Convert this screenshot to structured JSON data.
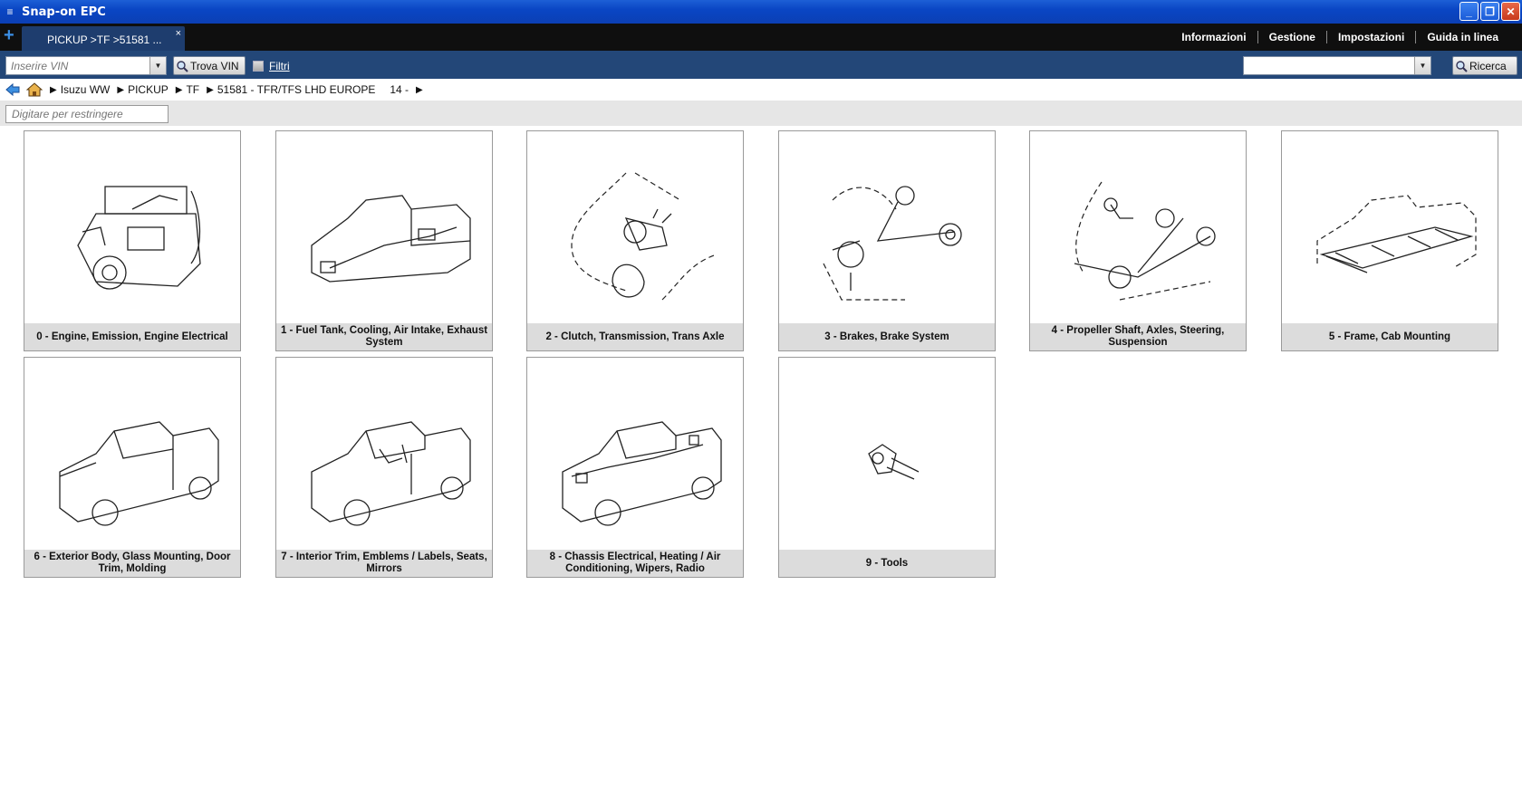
{
  "window": {
    "title": "Snap-on EPC"
  },
  "tabs": {
    "active_label": "PICKUP >TF >51581 ...",
    "close": "×",
    "add": "+"
  },
  "menu": [
    "Informazioni",
    "Gestione",
    "Impostazioni",
    "Guida in linea"
  ],
  "toolbar": {
    "vin_placeholder": "Inserire VIN",
    "trova_label": "Trova VIN",
    "filtri_label": "Filtri",
    "search_value": "",
    "ricerca_label": "Ricerca"
  },
  "breadcrumb": {
    "items": [
      "Isuzu WW",
      "PICKUP",
      "TF",
      "51581 - TFR/TFS LHD EUROPE"
    ],
    "step": "14 -"
  },
  "filter": {
    "placeholder": "Digitare per restringere"
  },
  "groups": [
    {
      "label": "0 - Engine, Emission, Engine Electrical",
      "icon": "engine-illustration"
    },
    {
      "label": "1 - Fuel Tank, Cooling, Air Intake, Exhaust System",
      "icon": "fuel-system-illustration"
    },
    {
      "label": "2 - Clutch, Transmission, Trans Axle",
      "icon": "transmission-illustration"
    },
    {
      "label": "3 - Brakes, Brake System",
      "icon": "brake-system-illustration"
    },
    {
      "label": "4 - Propeller Shaft, Axles, Steering, Suspension",
      "icon": "axles-steering-illustration"
    },
    {
      "label": "5 - Frame, Cab Mounting",
      "icon": "frame-illustration"
    },
    {
      "label": "6 - Exterior Body, Glass Mounting, Door Trim, Molding",
      "icon": "exterior-body-illustration"
    },
    {
      "label": "7 - Interior Trim, Emblems / Labels, Seats, Mirrors",
      "icon": "interior-trim-illustration"
    },
    {
      "label": "8 - Chassis Electrical, Heating / Air Conditioning, Wipers, Radio",
      "icon": "chassis-electrical-illustration"
    },
    {
      "label": "9 - Tools",
      "icon": "tools-illustration"
    }
  ]
}
